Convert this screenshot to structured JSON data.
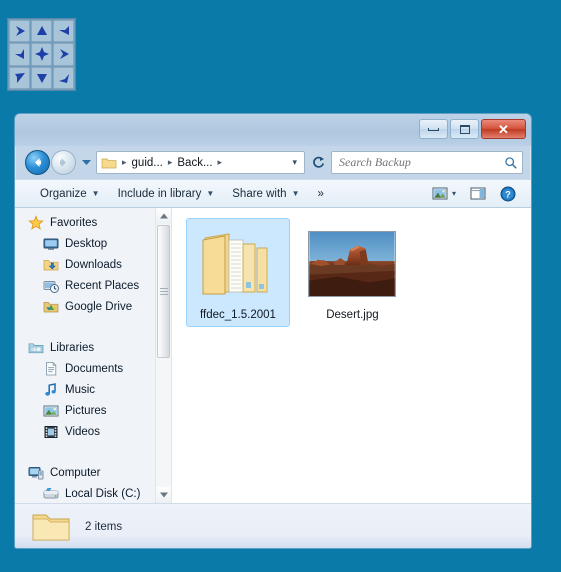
{
  "desktop": {
    "background_color": "#0a7ba8"
  },
  "dpad": {
    "name": "arrow-pad-widget",
    "keys": [
      {
        "id": "key-nw-flip",
        "icon": "triangle-right-icon",
        "rotate": 0
      },
      {
        "id": "key-n",
        "icon": "triangle-up-icon",
        "rotate": 0
      },
      {
        "id": "key-ne",
        "icon": "triangle-left-icon",
        "rotate": 0
      },
      {
        "id": "key-w",
        "icon": "triangle-left-icon",
        "rotate": 0
      },
      {
        "id": "key-center",
        "icon": "diamond-icon",
        "rotate": 0
      },
      {
        "id": "key-e",
        "icon": "triangle-right-icon",
        "rotate": 0
      },
      {
        "id": "key-sw",
        "icon": "triangle-right-icon",
        "rotate": 0
      },
      {
        "id": "key-s",
        "icon": "triangle-down-icon",
        "rotate": 0
      },
      {
        "id": "key-se",
        "icon": "triangle-left-icon",
        "rotate": 0
      }
    ],
    "colors": {
      "frame": "#6f9bbd",
      "key": "#a8c4d8",
      "glyph": "#1f3fa8"
    }
  },
  "window": {
    "title": "",
    "controls": {
      "minimize_label": "–",
      "maximize_label": "□",
      "close_label": "✕"
    },
    "navigation": {
      "back_tooltip": "Back",
      "forward_tooltip": "Forward",
      "recent_pages_label": "▾",
      "refresh_label": "Refresh"
    },
    "breadcrumb": {
      "items": [
        "guid...",
        "Back..."
      ],
      "separator": "▸",
      "dropdown_label": "▾"
    },
    "search": {
      "placeholder": "Search Backup",
      "value": "",
      "icon": "search-icon"
    },
    "toolbar": {
      "items": [
        {
          "label": "Organize",
          "has_caret": true,
          "name": "toolbar-organize"
        },
        {
          "label": "Include in library",
          "has_caret": true,
          "name": "toolbar-include-in-library"
        },
        {
          "label": "Share with",
          "has_caret": true,
          "name": "toolbar-share-with"
        },
        {
          "label": "»",
          "has_caret": false,
          "name": "toolbar-overflow"
        }
      ],
      "right_icons": [
        {
          "name": "change-view-icon",
          "caret": "▾"
        },
        {
          "name": "preview-pane-icon",
          "caret": ""
        },
        {
          "name": "help-icon",
          "caret": ""
        }
      ]
    },
    "navpane": {
      "groups": [
        {
          "header": {
            "label": "Favorites",
            "icon": "star-icon",
            "name": "nav-group-favorites"
          },
          "items": [
            {
              "label": "Desktop",
              "icon": "desktop-icon",
              "name": "nav-item-desktop"
            },
            {
              "label": "Downloads",
              "icon": "downloads-icon",
              "name": "nav-item-downloads"
            },
            {
              "label": "Recent Places",
              "icon": "recent-places-icon",
              "name": "nav-item-recent-places"
            },
            {
              "label": "Google Drive",
              "icon": "google-drive-icon",
              "name": "nav-item-google-drive"
            }
          ]
        },
        {
          "header": {
            "label": "Libraries",
            "icon": "libraries-icon",
            "name": "nav-group-libraries"
          },
          "items": [
            {
              "label": "Documents",
              "icon": "documents-icon",
              "name": "nav-item-documents"
            },
            {
              "label": "Music",
              "icon": "music-icon",
              "name": "nav-item-music"
            },
            {
              "label": "Pictures",
              "icon": "pictures-icon",
              "name": "nav-item-pictures"
            },
            {
              "label": "Videos",
              "icon": "videos-icon",
              "name": "nav-item-videos"
            }
          ]
        },
        {
          "header": {
            "label": "Computer",
            "icon": "computer-icon",
            "name": "nav-group-computer"
          },
          "items": [
            {
              "label": "Local Disk (C:)",
              "icon": "hard-disk-icon",
              "name": "nav-item-local-disk-c"
            }
          ]
        }
      ],
      "scrollbar": {
        "up_label": "▲",
        "down_label": "▼"
      }
    },
    "files": [
      {
        "name": "ffdec_1.5.2001",
        "type": "folder",
        "selected": true,
        "element_name": "file-item-folder"
      },
      {
        "name": "Desert.jpg",
        "type": "image",
        "selected": false,
        "element_name": "file-item-image"
      }
    ],
    "statusbar": {
      "icon": "folder-icon",
      "text": "2 items"
    }
  }
}
